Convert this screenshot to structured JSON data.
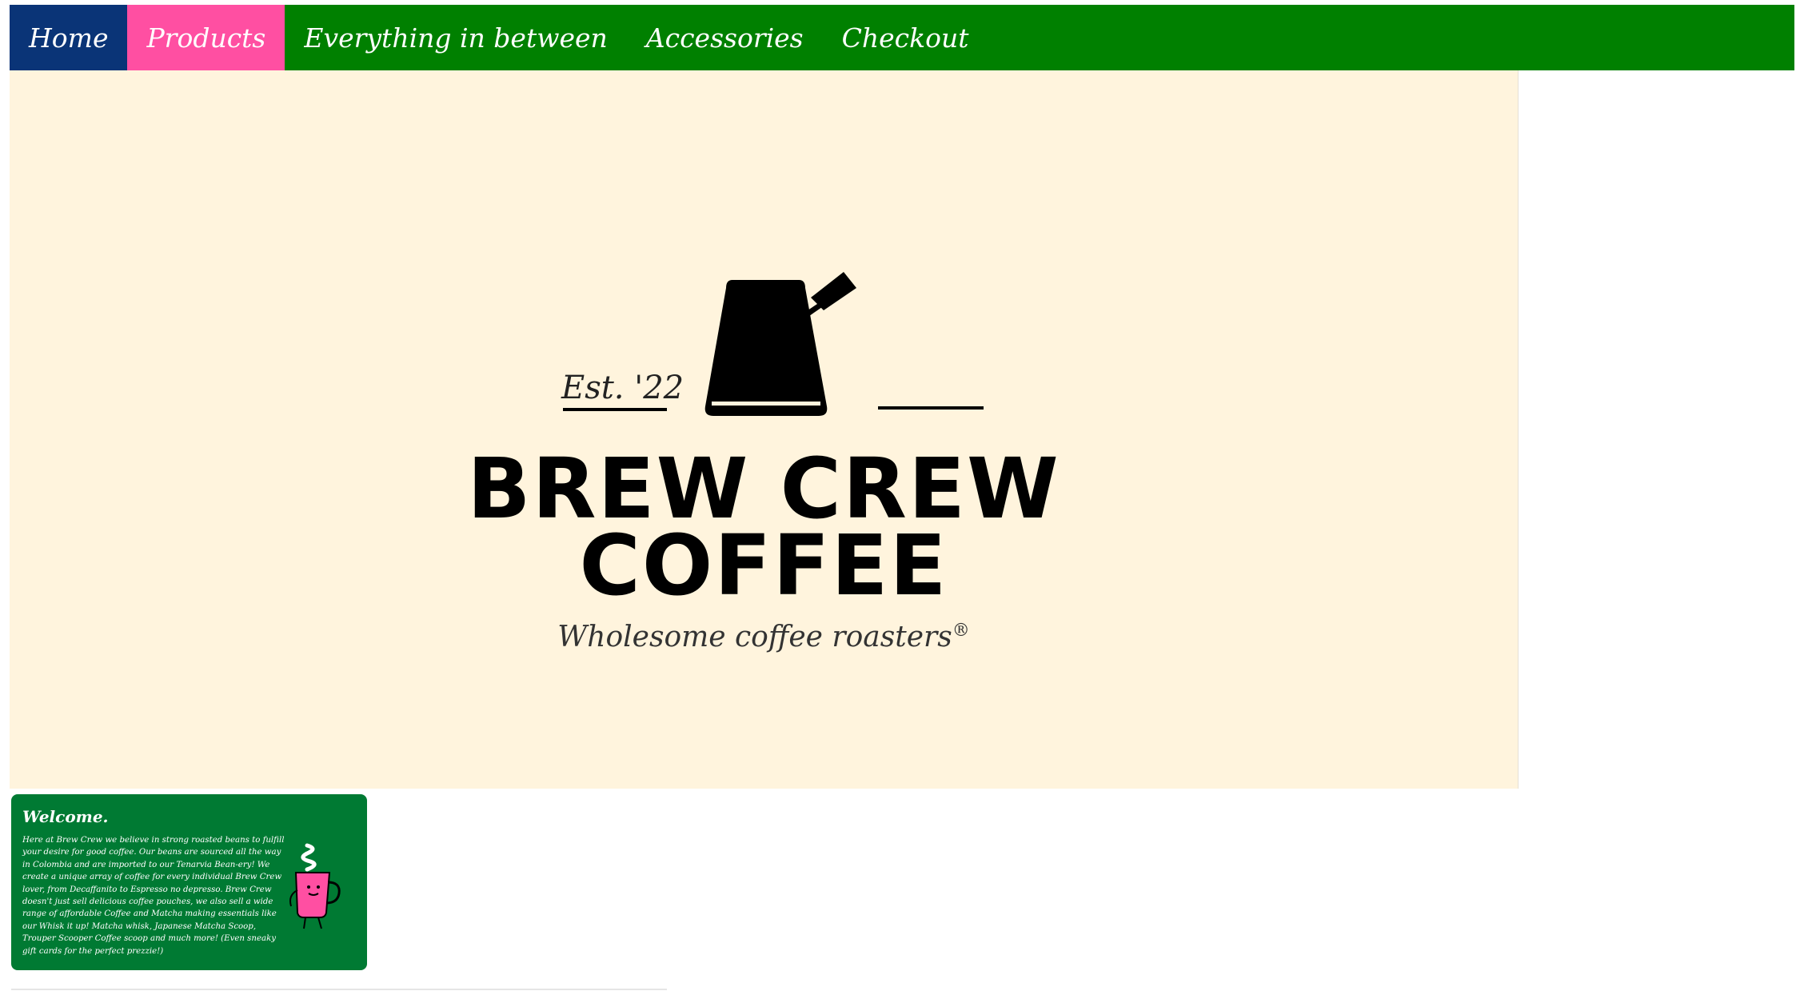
{
  "nav": {
    "items": [
      {
        "label": "Home"
      },
      {
        "label": "Products"
      },
      {
        "label": "Everything in between"
      },
      {
        "label": "Accessories"
      },
      {
        "label": "Checkout"
      }
    ]
  },
  "hero": {
    "est": "Est. '22",
    "brand_line1": "BREW CREW",
    "brand_line2": "COFFEE",
    "tagline": "Wholesome coffee roasters",
    "registered_mark": "®",
    "logo_icon": "coffee-pot-icon"
  },
  "welcome": {
    "title": "Welcome.",
    "body": "Here at Brew Crew we believe in strong roasted beans to fulfill your desire for good coffee. Our beans are sourced all the way in Colombia and are imported to our Tenarvia Bean-ery! We create a unique array of coffee for every individual Brew Crew lover, from Decaffanito to Espresso no depresso. Brew Crew doesn't just sell delicious coffee pouches, we also sell a wide range of affordable Coffee and Matcha making essentials like our Whisk it up! Matcha whisk, Japanese Matcha Scoop, Trouper Scooper Coffee scoop and much more! (Even sneaky gift cards for the perfect prezzie!)",
    "mascot_icon": "pink-mug-mascot-icon"
  },
  "colors": {
    "nav_bg": "#008000",
    "home_bg": "#0a3477",
    "products_bg": "#ff4fa2",
    "hero_bg": "#fff4dd",
    "welcome_bg": "#007a33"
  }
}
